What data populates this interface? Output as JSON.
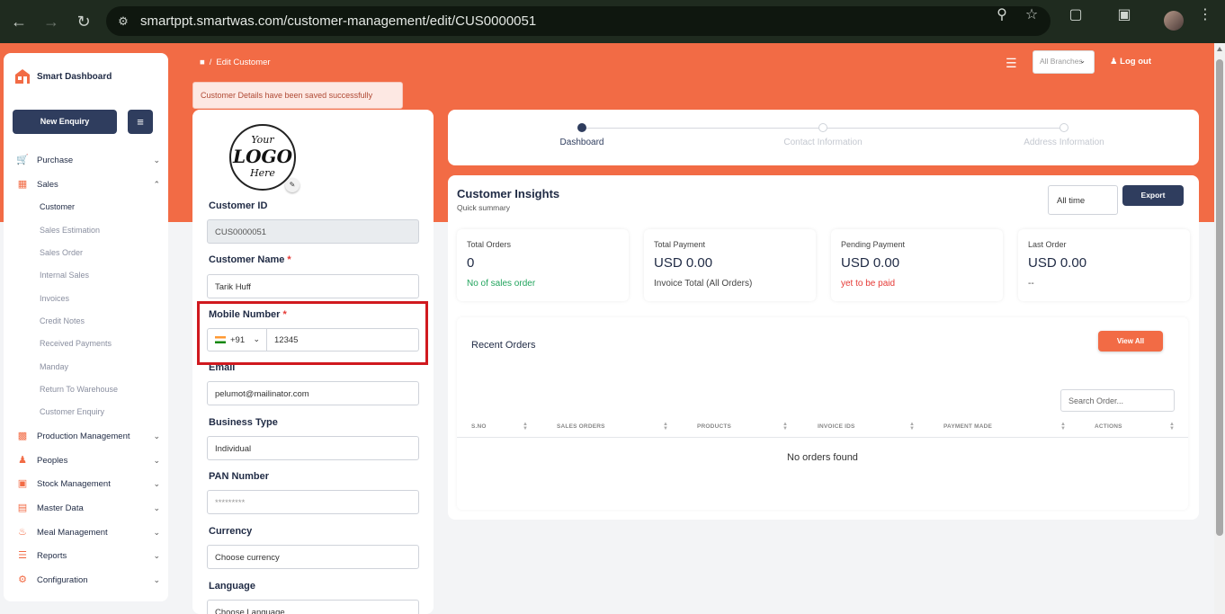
{
  "browser": {
    "url": "smartppt.smartwas.com/customer-management/edit/CUS0000051"
  },
  "sidebar": {
    "brand": "Smart Dashboard",
    "new_enquiry": "New Enquiry",
    "items": [
      {
        "label": "Purchase",
        "icon": "cart-icon"
      },
      {
        "label": "Sales",
        "icon": "sales-icon"
      },
      {
        "label": "Production Management",
        "icon": "factory-icon"
      },
      {
        "label": "Peoples",
        "icon": "people-icon"
      },
      {
        "label": "Stock Management",
        "icon": "box-icon"
      },
      {
        "label": "Master Data",
        "icon": "database-icon"
      },
      {
        "label": "Meal Management",
        "icon": "meal-icon"
      },
      {
        "label": "Reports",
        "icon": "report-icon"
      },
      {
        "label": "Configuration",
        "icon": "config-icon"
      }
    ],
    "sales_sub": [
      "Customer",
      "Sales Estimation",
      "Sales Order",
      "Internal Sales",
      "Invoices",
      "Credit Notes",
      "Received Payments",
      "Manday",
      "Return To Warehouse",
      "Customer Enquiry"
    ]
  },
  "header": {
    "breadcrumb": "Edit Customer",
    "branch": "All Branches",
    "logout": "Log out"
  },
  "toast": "Customer Details have been saved successfully",
  "form": {
    "logo_lines": [
      "Your",
      "LOGO",
      "Here"
    ],
    "customer_id_label": "Customer ID",
    "customer_id": "CUS0000051",
    "customer_name_label": "Customer Name",
    "customer_name": "Tarik Huff",
    "mobile_label": "Mobile Number",
    "country_code": "+91",
    "mobile": "12345",
    "email_label": "Email",
    "email": "pelumot@mailinator.com",
    "business_type_label": "Business Type",
    "business_type": "Individual",
    "pan_label": "PAN Number",
    "pan_placeholder": "*********",
    "currency_label": "Currency",
    "currency_placeholder": "Choose currency",
    "language_label": "Language",
    "language_placeholder": "Choose Language",
    "required_mark": "*"
  },
  "stepper": {
    "steps": [
      "Dashboard",
      "Contact Information",
      "Address Information"
    ]
  },
  "insights": {
    "title": "Customer Insights",
    "subtitle": "Quick summary",
    "time_filter": "All time",
    "export": "Export",
    "stats": [
      {
        "label": "Total Orders",
        "value": "0",
        "note": "No of sales order",
        "note_color": "#22a45d"
      },
      {
        "label": "Total Payment",
        "value": "USD 0.00",
        "note": "Invoice Total (All Orders)",
        "note_color": "#444444"
      },
      {
        "label": "Pending Payment",
        "value": "USD 0.00",
        "note": "yet to be paid",
        "note_color": "#e53935"
      },
      {
        "label": "Last Order",
        "value": "USD 0.00",
        "note": "--",
        "note_color": "#444444"
      }
    ],
    "recent_title": "Recent Orders",
    "view_all": "View All",
    "search_placeholder": "Search Order...",
    "columns": [
      "S.NO",
      "SALES ORDERS",
      "PRODUCTS",
      "INVOICE IDS",
      "PAYMENT MADE",
      "ACTIONS"
    ],
    "empty": "No orders found"
  },
  "colors": {
    "accent": "#f26b45",
    "navy": "#2f3d5e",
    "highlight": "#d0191f"
  }
}
